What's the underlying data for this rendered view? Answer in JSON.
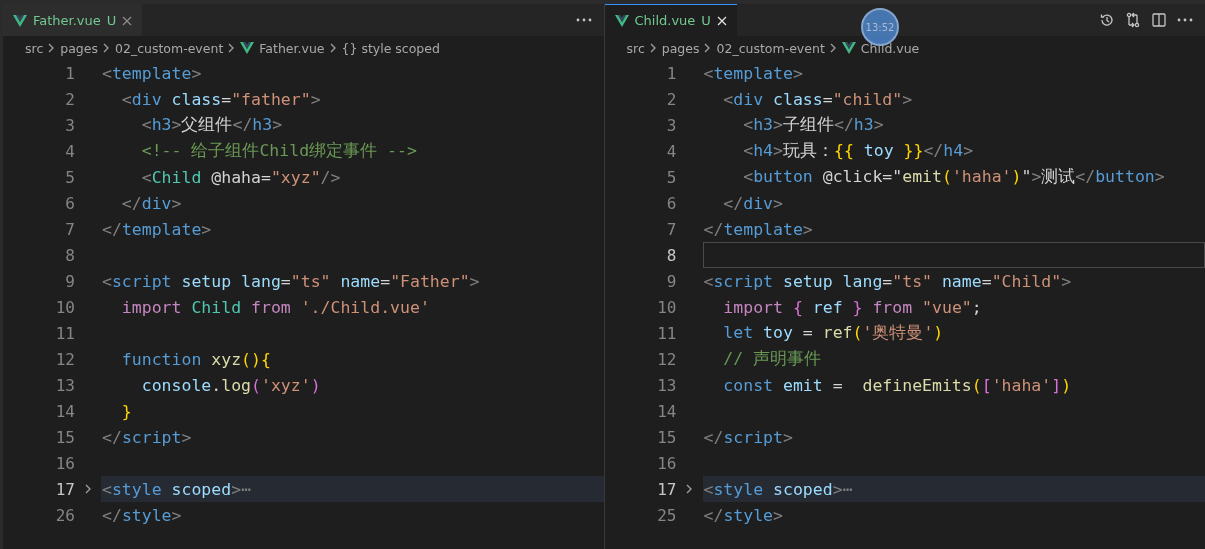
{
  "panes": [
    {
      "tab": {
        "file": "Father.vue",
        "status": "U",
        "selected": false
      },
      "breadcrumb": [
        "src",
        "pages",
        "02_custom-event",
        "Father.vue",
        "{} style scoped"
      ],
      "lines": [
        {
          "number": "1",
          "highlighted": false,
          "cursor_line": false,
          "folded": false,
          "tokens": [
            {
              "kind": "punct",
              "text": "<"
            },
            {
              "kind": "tag",
              "text": "template"
            },
            {
              "kind": "punct",
              "text": ">"
            }
          ]
        },
        {
          "number": "2",
          "highlighted": false,
          "cursor_line": false,
          "folded": false,
          "tokens": [
            {
              "kind": "punct",
              "text": "  <"
            },
            {
              "kind": "tag",
              "text": "div "
            },
            {
              "kind": "attr",
              "text": "class"
            },
            {
              "kind": "plain",
              "text": "="
            },
            {
              "kind": "str",
              "text": "\"father\""
            },
            {
              "kind": "punct",
              "text": ">"
            }
          ]
        },
        {
          "number": "3",
          "highlighted": false,
          "cursor_line": false,
          "folded": false,
          "tokens": [
            {
              "kind": "punct",
              "text": "    <"
            },
            {
              "kind": "tag",
              "text": "h3"
            },
            {
              "kind": "punct",
              "text": ">"
            },
            {
              "kind": "plain",
              "text": "父组件"
            },
            {
              "kind": "punct",
              "text": "</"
            },
            {
              "kind": "tag",
              "text": "h3"
            },
            {
              "kind": "punct",
              "text": ">"
            }
          ]
        },
        {
          "number": "4",
          "highlighted": false,
          "cursor_line": false,
          "folded": false,
          "tokens": [
            {
              "kind": "comment",
              "text": "    <!-- 给子组件Child绑定事件 -->"
            }
          ]
        },
        {
          "number": "5",
          "highlighted": false,
          "cursor_line": false,
          "folded": false,
          "tokens": [
            {
              "kind": "punct",
              "text": "    <"
            },
            {
              "kind": "component",
              "text": "Child "
            },
            {
              "kind": "plain",
              "text": "@haha="
            },
            {
              "kind": "str",
              "text": "\"xyz\""
            },
            {
              "kind": "punct",
              "text": "/>"
            }
          ]
        },
        {
          "number": "6",
          "highlighted": false,
          "cursor_line": false,
          "folded": false,
          "tokens": [
            {
              "kind": "punct",
              "text": "  </"
            },
            {
              "kind": "tag",
              "text": "div"
            },
            {
              "kind": "punct",
              "text": ">"
            }
          ]
        },
        {
          "number": "7",
          "highlighted": false,
          "cursor_line": false,
          "folded": false,
          "tokens": [
            {
              "kind": "punct",
              "text": "</"
            },
            {
              "kind": "tag",
              "text": "template"
            },
            {
              "kind": "punct",
              "text": ">"
            }
          ]
        },
        {
          "number": "8",
          "highlighted": false,
          "cursor_line": false,
          "folded": false
        },
        {
          "number": "9",
          "highlighted": false,
          "cursor_line": false,
          "folded": false,
          "tokens": [
            {
              "kind": "punct",
              "text": "<"
            },
            {
              "kind": "tag",
              "text": "script "
            },
            {
              "kind": "attr",
              "text": "setup lang"
            },
            {
              "kind": "plain",
              "text": "="
            },
            {
              "kind": "str",
              "text": "\"ts\" "
            },
            {
              "kind": "attr",
              "text": "name"
            },
            {
              "kind": "plain",
              "text": "="
            },
            {
              "kind": "str",
              "text": "\"Father\""
            },
            {
              "kind": "punct",
              "text": ">"
            }
          ]
        },
        {
          "number": "10",
          "highlighted": false,
          "cursor_line": false,
          "folded": false,
          "tokens": [
            {
              "kind": "keyword",
              "text": "  import "
            },
            {
              "kind": "component",
              "text": "Child "
            },
            {
              "kind": "keyword",
              "text": "from "
            },
            {
              "kind": "str",
              "text": "'./Child.vue'"
            }
          ]
        },
        {
          "number": "11",
          "highlighted": false,
          "cursor_line": false,
          "folded": false
        },
        {
          "number": "12",
          "highlighted": false,
          "cursor_line": false,
          "folded": false,
          "tokens": [
            {
              "kind": "storage",
              "text": "  function "
            },
            {
              "kind": "func",
              "text": "xyz"
            },
            {
              "kind": "bracket",
              "text": "(){"
            }
          ]
        },
        {
          "number": "13",
          "highlighted": false,
          "cursor_line": false,
          "folded": false,
          "tokens": [
            {
              "kind": "var",
              "text": "    console"
            },
            {
              "kind": "plain",
              "text": "."
            },
            {
              "kind": "func",
              "text": "log"
            },
            {
              "kind": "bracket2",
              "text": "("
            },
            {
              "kind": "str",
              "text": "'xyz'"
            },
            {
              "kind": "bracket2",
              "text": ")"
            }
          ]
        },
        {
          "number": "14",
          "highlighted": false,
          "cursor_line": false,
          "folded": false,
          "tokens": [
            {
              "kind": "bracket",
              "text": "  }"
            }
          ]
        },
        {
          "number": "15",
          "highlighted": false,
          "cursor_line": false,
          "folded": false,
          "tokens": [
            {
              "kind": "punct",
              "text": "</"
            },
            {
              "kind": "tag",
              "text": "script"
            },
            {
              "kind": "punct",
              "text": ">"
            }
          ]
        },
        {
          "number": "16",
          "highlighted": false,
          "cursor_line": false,
          "folded": false
        },
        {
          "number": "17",
          "highlighted": true,
          "cursor_line": false,
          "folded": true,
          "tokens": [
            {
              "kind": "punct",
              "text": "<"
            },
            {
              "kind": "tag",
              "text": "style "
            },
            {
              "kind": "attr",
              "text": "scoped"
            },
            {
              "kind": "punct",
              "text": ">⋯"
            }
          ]
        },
        {
          "number": "26",
          "highlighted": false,
          "cursor_line": false,
          "folded": false,
          "tokens": [
            {
              "kind": "punct",
              "text": "</"
            },
            {
              "kind": "tag",
              "text": "style"
            },
            {
              "kind": "punct",
              "text": ">"
            }
          ]
        }
      ]
    },
    {
      "tab": {
        "file": "Child.vue",
        "status": "U",
        "selected": true
      },
      "breadcrumb": [
        "src",
        "pages",
        "02_custom-event",
        "Child.vue"
      ],
      "lines": [
        {
          "number": "1",
          "highlighted": false,
          "cursor_line": false,
          "folded": false,
          "tokens": [
            {
              "kind": "punct",
              "text": "<"
            },
            {
              "kind": "tag",
              "text": "template"
            },
            {
              "kind": "punct",
              "text": ">"
            }
          ]
        },
        {
          "number": "2",
          "highlighted": false,
          "cursor_line": false,
          "folded": false,
          "tokens": [
            {
              "kind": "punct",
              "text": "  <"
            },
            {
              "kind": "tag",
              "text": "div "
            },
            {
              "kind": "attr",
              "text": "class"
            },
            {
              "kind": "plain",
              "text": "="
            },
            {
              "kind": "str",
              "text": "\"child\""
            },
            {
              "kind": "punct",
              "text": ">"
            }
          ]
        },
        {
          "number": "3",
          "highlighted": false,
          "cursor_line": false,
          "folded": false,
          "tokens": [
            {
              "kind": "punct",
              "text": "    <"
            },
            {
              "kind": "tag",
              "text": "h3"
            },
            {
              "kind": "punct",
              "text": ">"
            },
            {
              "kind": "plain",
              "text": "子组件"
            },
            {
              "kind": "punct",
              "text": "</"
            },
            {
              "kind": "tag",
              "text": "h3"
            },
            {
              "kind": "punct",
              "text": ">"
            }
          ]
        },
        {
          "number": "4",
          "highlighted": false,
          "cursor_line": false,
          "folded": false,
          "tokens": [
            {
              "kind": "punct",
              "text": "    <"
            },
            {
              "kind": "tag",
              "text": "h4"
            },
            {
              "kind": "punct",
              "text": ">"
            },
            {
              "kind": "plain",
              "text": "玩具："
            },
            {
              "kind": "bracket",
              "text": "{{ "
            },
            {
              "kind": "var",
              "text": "toy "
            },
            {
              "kind": "bracket",
              "text": "}}"
            },
            {
              "kind": "punct",
              "text": "</"
            },
            {
              "kind": "tag",
              "text": "h4"
            },
            {
              "kind": "punct",
              "text": ">"
            }
          ]
        },
        {
          "number": "5",
          "highlighted": false,
          "cursor_line": false,
          "folded": false,
          "tokens": [
            {
              "kind": "punct",
              "text": "    <"
            },
            {
              "kind": "tag",
              "text": "button "
            },
            {
              "kind": "plain",
              "text": "@click=\""
            },
            {
              "kind": "func",
              "text": "emit"
            },
            {
              "kind": "bracket",
              "text": "("
            },
            {
              "kind": "str",
              "text": "'haha'"
            },
            {
              "kind": "bracket",
              "text": ")"
            },
            {
              "kind": "plain",
              "text": "\""
            },
            {
              "kind": "punct",
              "text": ">"
            },
            {
              "kind": "plain",
              "text": "测试"
            },
            {
              "kind": "punct",
              "text": "</"
            },
            {
              "kind": "tag",
              "text": "button"
            },
            {
              "kind": "punct",
              "text": ">"
            }
          ]
        },
        {
          "number": "6",
          "highlighted": false,
          "cursor_line": false,
          "folded": false,
          "tokens": [
            {
              "kind": "punct",
              "text": "  </"
            },
            {
              "kind": "tag",
              "text": "div"
            },
            {
              "kind": "punct",
              "text": ">"
            }
          ]
        },
        {
          "number": "7",
          "highlighted": false,
          "cursor_line": false,
          "folded": false,
          "tokens": [
            {
              "kind": "punct",
              "text": "</"
            },
            {
              "kind": "tag",
              "text": "template"
            },
            {
              "kind": "punct",
              "text": ">"
            }
          ]
        },
        {
          "number": "8",
          "highlighted": false,
          "cursor_line": true,
          "folded": false
        },
        {
          "number": "9",
          "highlighted": false,
          "cursor_line": false,
          "folded": false,
          "tokens": [
            {
              "kind": "punct",
              "text": "<"
            },
            {
              "kind": "tag",
              "text": "script "
            },
            {
              "kind": "attr",
              "text": "setup lang"
            },
            {
              "kind": "plain",
              "text": "="
            },
            {
              "kind": "str",
              "text": "\"ts\" "
            },
            {
              "kind": "attr",
              "text": "name"
            },
            {
              "kind": "plain",
              "text": "="
            },
            {
              "kind": "str",
              "text": "\"Child\""
            },
            {
              "kind": "punct",
              "text": ">"
            }
          ]
        },
        {
          "number": "10",
          "highlighted": false,
          "cursor_line": false,
          "folded": false,
          "tokens": [
            {
              "kind": "keyword",
              "text": "  import "
            },
            {
              "kind": "bracket3",
              "text": "{ "
            },
            {
              "kind": "var",
              "text": "ref "
            },
            {
              "kind": "bracket3",
              "text": "} "
            },
            {
              "kind": "keyword",
              "text": "from "
            },
            {
              "kind": "str",
              "text": "\"vue\""
            },
            {
              "kind": "plain",
              "text": ";"
            }
          ]
        },
        {
          "number": "11",
          "highlighted": false,
          "cursor_line": false,
          "folded": false,
          "tokens": [
            {
              "kind": "storage",
              "text": "  let "
            },
            {
              "kind": "var",
              "text": "toy "
            },
            {
              "kind": "plain",
              "text": "= "
            },
            {
              "kind": "func",
              "text": "ref"
            },
            {
              "kind": "bracket",
              "text": "("
            },
            {
              "kind": "str",
              "text": "'奥特曼'"
            },
            {
              "kind": "bracket",
              "text": ")"
            }
          ]
        },
        {
          "number": "12",
          "highlighted": false,
          "cursor_line": false,
          "folded": false,
          "tokens": [
            {
              "kind": "comment",
              "text": "  // 声明事件"
            }
          ]
        },
        {
          "number": "13",
          "highlighted": false,
          "cursor_line": false,
          "folded": false,
          "tokens": [
            {
              "kind": "storage",
              "text": "  const "
            },
            {
              "kind": "var",
              "text": "emit "
            },
            {
              "kind": "plain",
              "text": "=  "
            },
            {
              "kind": "func",
              "text": "defineEmits"
            },
            {
              "kind": "bracket",
              "text": "("
            },
            {
              "kind": "bracket2",
              "text": "["
            },
            {
              "kind": "str",
              "text": "'haha'"
            },
            {
              "kind": "bracket2",
              "text": "]"
            },
            {
              "kind": "bracket",
              "text": ")"
            }
          ]
        },
        {
          "number": "14",
          "highlighted": false,
          "cursor_line": false,
          "folded": false
        },
        {
          "number": "15",
          "highlighted": false,
          "cursor_line": false,
          "folded": false,
          "tokens": [
            {
              "kind": "punct",
              "text": "</"
            },
            {
              "kind": "tag",
              "text": "script"
            },
            {
              "kind": "punct",
              "text": ">"
            }
          ]
        },
        {
          "number": "16",
          "highlighted": false,
          "cursor_line": false,
          "folded": false
        },
        {
          "number": "17",
          "highlighted": true,
          "cursor_line": false,
          "folded": true,
          "tokens": [
            {
              "kind": "punct",
              "text": "<"
            },
            {
              "kind": "tag",
              "text": "style "
            },
            {
              "kind": "attr",
              "text": "scoped"
            },
            {
              "kind": "punct",
              "text": ">⋯"
            }
          ]
        },
        {
          "number": "25",
          "highlighted": false,
          "cursor_line": false,
          "folded": false,
          "tokens": [
            {
              "kind": "punct",
              "text": "</"
            },
            {
              "kind": "tag",
              "text": "style"
            },
            {
              "kind": "punct",
              "text": ">"
            }
          ]
        }
      ]
    }
  ],
  "clock_badge": "13:52"
}
